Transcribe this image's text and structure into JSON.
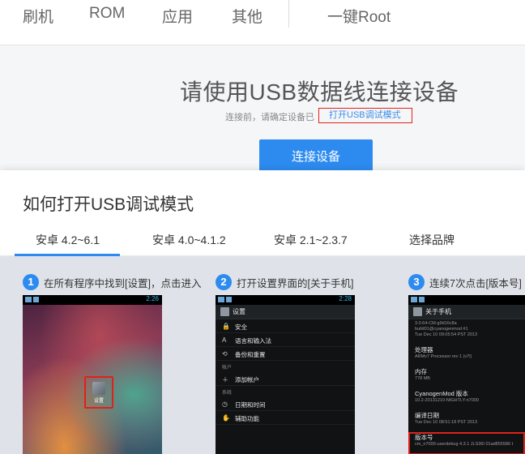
{
  "nav": {
    "items": [
      "刷机",
      "ROM",
      "应用",
      "其他"
    ],
    "root_link": "一键Root"
  },
  "hero": {
    "title": "请使用USB数据线连接设备",
    "subtitle": "连接前，请确定设备已",
    "link": "打开USB调试模式",
    "button": "连接设备"
  },
  "guide": {
    "title": "如何打开USB调试模式",
    "tabs": [
      "安卓 4.2~6.1",
      "安卓 4.0~4.1.2",
      "安卓 2.1~2.3.7",
      "选择品牌"
    ],
    "active_tab": 0,
    "steps": [
      {
        "num": "1",
        "text": "在所有程序中找到[设置]，点击进入"
      },
      {
        "num": "2",
        "text": "打开设置界面的[关于手机]"
      },
      {
        "num": "3",
        "text": "连续7次点击[版本号]"
      }
    ]
  },
  "phone1": {
    "time": "2:26",
    "app_label": "设置"
  },
  "phone2": {
    "time": "2:28",
    "header": "设置",
    "rows": [
      {
        "icon": "🔒",
        "label": "安全"
      },
      {
        "icon": "A",
        "label": "语言和输入法"
      },
      {
        "icon": "⟲",
        "label": "备份和重置"
      }
    ],
    "category1": "帐户",
    "add_account": {
      "icon": "＋",
      "label": "添加帐户"
    },
    "category2": "系统",
    "rows2": [
      {
        "icon": "◷",
        "label": "日期和时间"
      },
      {
        "icon": "✋",
        "label": "辅助功能"
      }
    ]
  },
  "phone3": {
    "header": "关于手机",
    "top_lines": [
      "3.0.64-CM-g9d16c8a",
      "build01@cyanogenmod #1",
      "Tue Dec 10 09:05:54 PST 2013"
    ],
    "entries": [
      {
        "title": "处理器",
        "value": "ARMv7 Processor rev 1 (v7l)"
      },
      {
        "title": "内存",
        "value": "778 MB"
      },
      {
        "title": "CyanogenMod 版本",
        "value": "10.2-20131210-NIGHTLY-n7000"
      },
      {
        "title": "编译日期",
        "value": "Tue Dec 10 08:51:18 PST 2013"
      },
      {
        "title": "版本号",
        "value": "cm_n7000-userdebug 4.3.1 JLS36I 01ad855586 t"
      }
    ]
  }
}
